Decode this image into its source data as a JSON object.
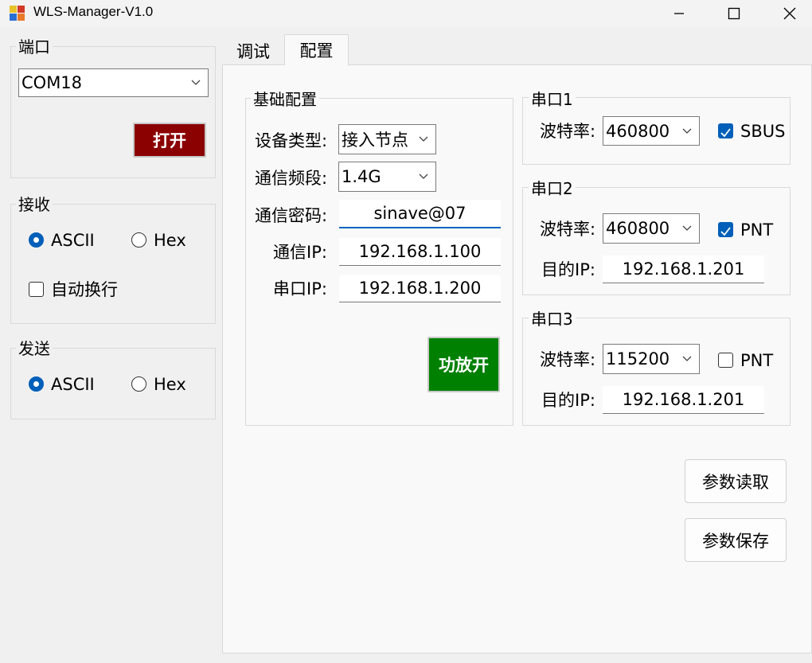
{
  "window": {
    "title": "WLS-Manager-V1.0"
  },
  "port_group": {
    "title": "端口",
    "com_value": "COM18",
    "open_button": "打开"
  },
  "receive_group": {
    "title": "接收",
    "ascii_label": "ASCII",
    "hex_label": "Hex",
    "auto_wrap_label": "自动换行"
  },
  "send_group": {
    "title": "发送",
    "ascii_label": "ASCII",
    "hex_label": "Hex"
  },
  "tabs": [
    {
      "label": "调试",
      "active": false
    },
    {
      "label": "配置",
      "active": true
    }
  ],
  "basic_config": {
    "title": "基础配置",
    "device_type_label": "设备类型:",
    "device_type_value": "接入节点",
    "band_label": "通信频段:",
    "band_value": "1.4G",
    "password_label": "通信密码:",
    "password_value": "sinave@07",
    "comm_ip_label": "通信IP:",
    "comm_ip_value": "192.168.1.100",
    "serial_ip_label": "串口IP:",
    "serial_ip_value": "192.168.1.200",
    "amp_button": "功放开"
  },
  "serial1": {
    "title": "串口1",
    "baud_label": "波特率:",
    "baud_value": "460800",
    "check_label": "SBUS",
    "checked": true
  },
  "serial2": {
    "title": "串口2",
    "baud_label": "波特率:",
    "baud_value": "460800",
    "check_label": "PNT",
    "checked": true,
    "dest_ip_label": "目的IP:",
    "dest_ip_value": "192.168.1.201"
  },
  "serial3": {
    "title": "串口3",
    "baud_label": "波特率:",
    "baud_value": "115200",
    "check_label": "PNT",
    "checked": false,
    "dest_ip_label": "目的IP:",
    "dest_ip_value": "192.168.1.201"
  },
  "actions": {
    "read_button": "参数读取",
    "save_button": "参数保存"
  },
  "colors": {
    "open_button": "#8b0000",
    "amp_button": "#008000",
    "accent": "#005fb8"
  }
}
